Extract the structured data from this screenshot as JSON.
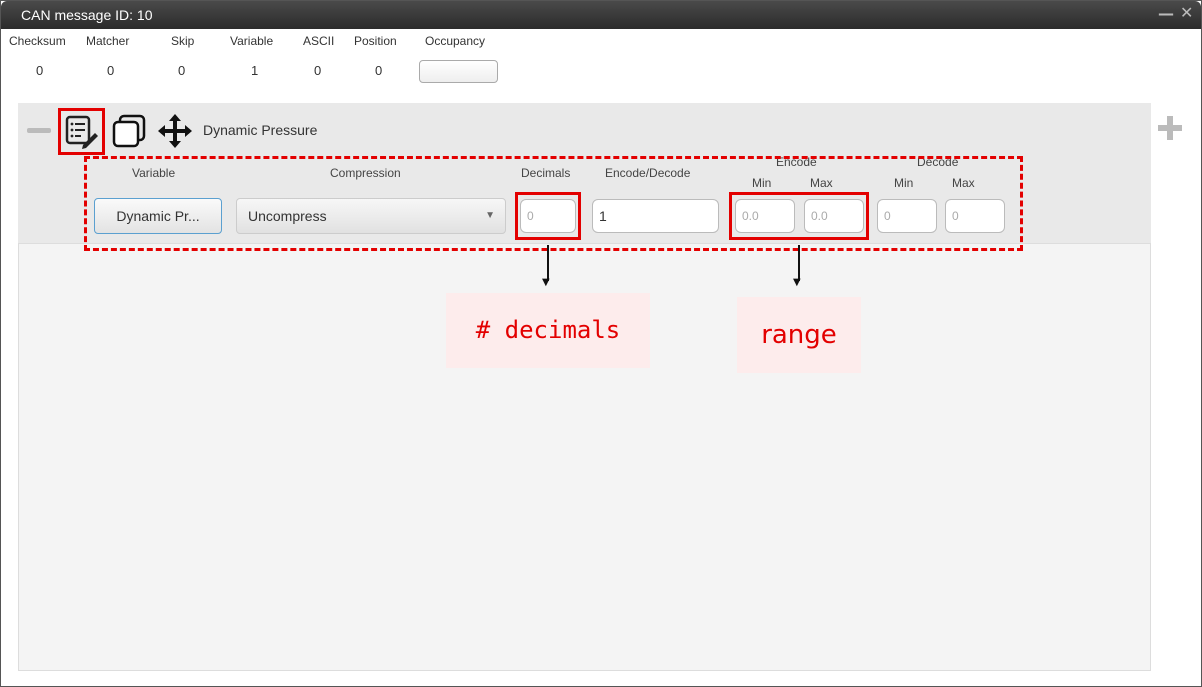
{
  "window": {
    "title": "CAN message ID: 10",
    "minimize_glyph": "—",
    "close_glyph": "✕"
  },
  "stats": [
    {
      "label": "Checksum",
      "value": "0"
    },
    {
      "label": "Matcher",
      "value": "0"
    },
    {
      "label": "Skip",
      "value": "0"
    },
    {
      "label": "Variable",
      "value": "1"
    },
    {
      "label": "ASCII",
      "value": "0"
    },
    {
      "label": "Position",
      "value": "0"
    },
    {
      "label": "Occupancy",
      "value": ""
    }
  ],
  "row": {
    "title": "Dynamic Pressure",
    "icons": [
      "minus-icon",
      "edit-list-icon",
      "copy-icon",
      "move-icon",
      "plus-icon"
    ]
  },
  "columns": {
    "variable": "Variable",
    "compression": "Compression",
    "decimals": "Decimals",
    "encode_decode": "Encode/Decode",
    "encode": "Encode",
    "decode": "Decode",
    "min": "Min",
    "max": "Max"
  },
  "fields": {
    "variable_button": "Dynamic Pr...",
    "compression_value": "Uncompress",
    "decimals_placeholder": "0",
    "encode_decode_value": "1",
    "encode_min_placeholder": "0.0",
    "encode_max_placeholder": "0.0",
    "decode_min_placeholder": "0",
    "decode_max_placeholder": "0"
  },
  "annotations": {
    "decimals_callout": "# decimals",
    "range_callout": "range",
    "highlight_color": "#e30000",
    "callout_bg": "#fdecec"
  }
}
